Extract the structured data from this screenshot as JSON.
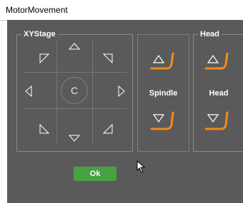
{
  "window": {
    "title": "MotorMovement"
  },
  "xy_stage": {
    "legend": "XYStage",
    "center_label": "C"
  },
  "spindle": {
    "legend": "",
    "label": "Spindle"
  },
  "head": {
    "legend": "Head",
    "label": "Head"
  },
  "ok_label": "Ok",
  "colors": {
    "background": "#5a5a5a",
    "accent_orange": "#f28a1c",
    "ok_green": "#46a141"
  }
}
